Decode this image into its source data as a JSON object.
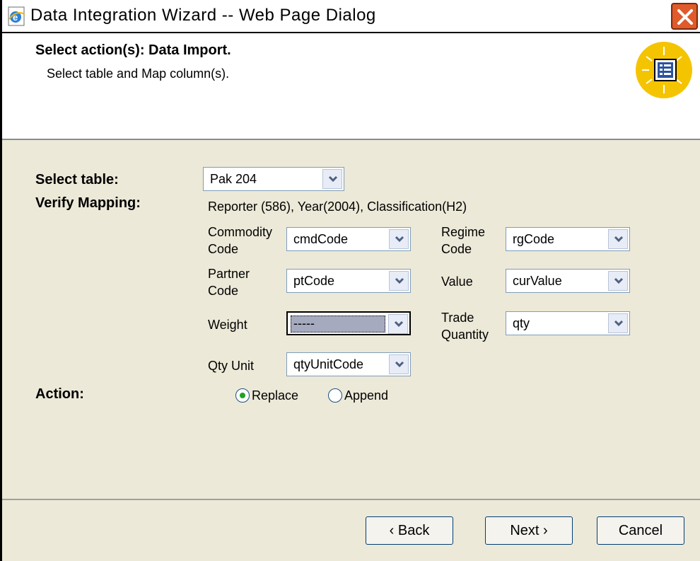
{
  "window": {
    "title": "Data Integration Wizard -- Web Page Dialog"
  },
  "header": {
    "title": "Select action(s): Data Import.",
    "subtitle": "Select table and Map column(s)."
  },
  "form": {
    "select_table_label": "Select table:",
    "select_table_value": "Pak 204",
    "verify_mapping_label": "Verify Mapping:",
    "mapping_info": "Reporter (586), Year(2004), Classification(H2)",
    "commodity_code": {
      "label_line1": "Commodity",
      "label_line2": "Code",
      "value": "cmdCode"
    },
    "regime_code": {
      "label_line1": "Regime",
      "label_line2": "Code",
      "value": "rgCode"
    },
    "partner_code": {
      "label_line1": "Partner",
      "label_line2": "Code",
      "value": "ptCode"
    },
    "value_field": {
      "label": "Value",
      "value": "curValue"
    },
    "weight": {
      "label": "Weight",
      "value": "-----"
    },
    "trade_quantity": {
      "label_line1": "Trade",
      "label_line2": "Quantity",
      "value": "qty"
    },
    "qty_unit": {
      "label": "Qty Unit",
      "value": "qtyUnitCode"
    },
    "action_label": "Action:",
    "action_options": {
      "replace": "Replace",
      "append": "Append",
      "selected": "Replace"
    }
  },
  "footer": {
    "back_label": "‹ Back",
    "next_label": "Next ›",
    "cancel_label": "Cancel"
  },
  "colors": {
    "dialog_bg": "#ece9d8",
    "radio_selected": "#21a121",
    "close_button": "#e05a2a"
  }
}
